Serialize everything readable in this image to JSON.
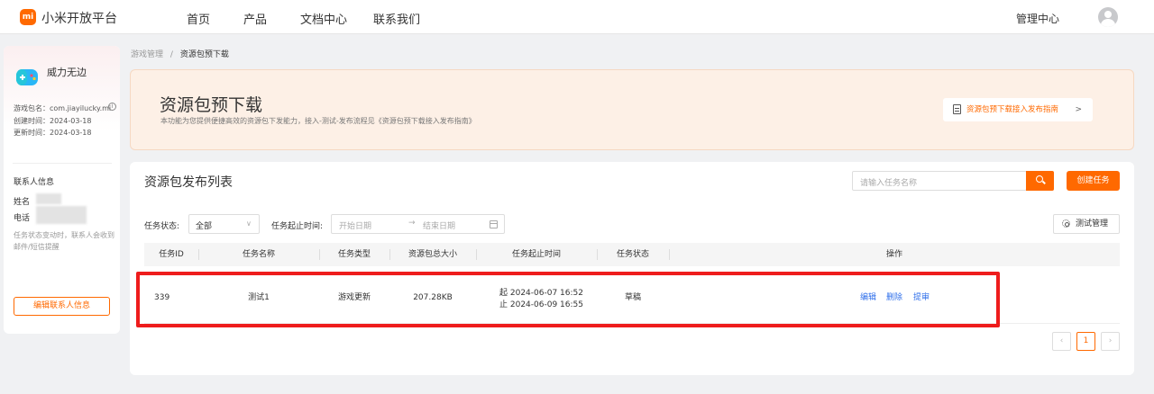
{
  "header": {
    "logo_text": "mi",
    "brand": "小米开放平台",
    "nav": [
      "首页",
      "产品",
      "文档中心",
      "联系我们"
    ],
    "manage": "管理中心"
  },
  "sidebar": {
    "game_name": "威力无边",
    "package": "游戏包名：com.jiayilucky.mi",
    "created": "创建时间：2024-03-18",
    "updated": "更新时间：2024-03-18",
    "contact_title": "联系人信息",
    "name_label": "姓名",
    "phone_label": "电话",
    "hint": "任务状态变动时，联系人会收到邮件/短信提醒",
    "edit_button": "编辑联系人信息"
  },
  "breadcrumb": {
    "parent": "游戏管理",
    "separator": "/",
    "current": "资源包预下载"
  },
  "banner": {
    "title": "资源包预下载",
    "desc": "本功能为您提供便捷高效的资源包下发能力，接入-测试-发布流程见《资源包预下载接入发布指南》",
    "guide_link": "资源包预下载接入发布指南"
  },
  "panel": {
    "title": "资源包发布列表",
    "search_placeholder": "请输入任务名称",
    "create_button": "创建任务",
    "status_label": "任务状态:",
    "status_value": "全部",
    "time_label": "任务起止时间:",
    "start_placeholder": "开始日期",
    "arrow": "→",
    "end_placeholder": "结束日期",
    "test_button": "测试管理",
    "columns": [
      "任务ID",
      "任务名称",
      "任务类型",
      "资源包总大小",
      "任务起止时间",
      "任务状态",
      "操作"
    ],
    "row": {
      "id": "339",
      "name": "测试1",
      "type": "游戏更新",
      "size": "207.28KB",
      "start": "起 2024-06-07 16:52",
      "end": "止 2024-06-09 16:55",
      "status": "草稿",
      "actions": [
        "编辑",
        "删除",
        "提审"
      ]
    }
  },
  "pagination": {
    "prev": "‹",
    "current": "1",
    "next": "›"
  }
}
